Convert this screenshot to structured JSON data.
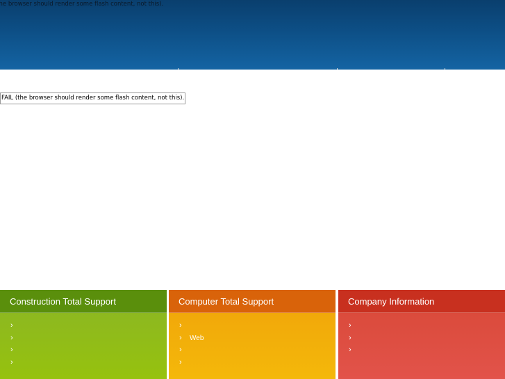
{
  "header": {
    "flash_fallback": "FAIL (the browser should render some flash content, not this)."
  },
  "main": {
    "flash_fallback": "FAIL (the browser should render some flash content, not this)."
  },
  "panels": [
    {
      "title": "Construction Total Support",
      "items": [
        "",
        "",
        "",
        ""
      ],
      "color": "#5a8f0c"
    },
    {
      "title": "Computer Total Support",
      "items": [
        "",
        "Web",
        "",
        ""
      ],
      "color": "#d9630a"
    },
    {
      "title": "Company Information",
      "items": [
        "",
        "",
        ""
      ],
      "color": "#c8301f"
    }
  ],
  "chevron": "›"
}
